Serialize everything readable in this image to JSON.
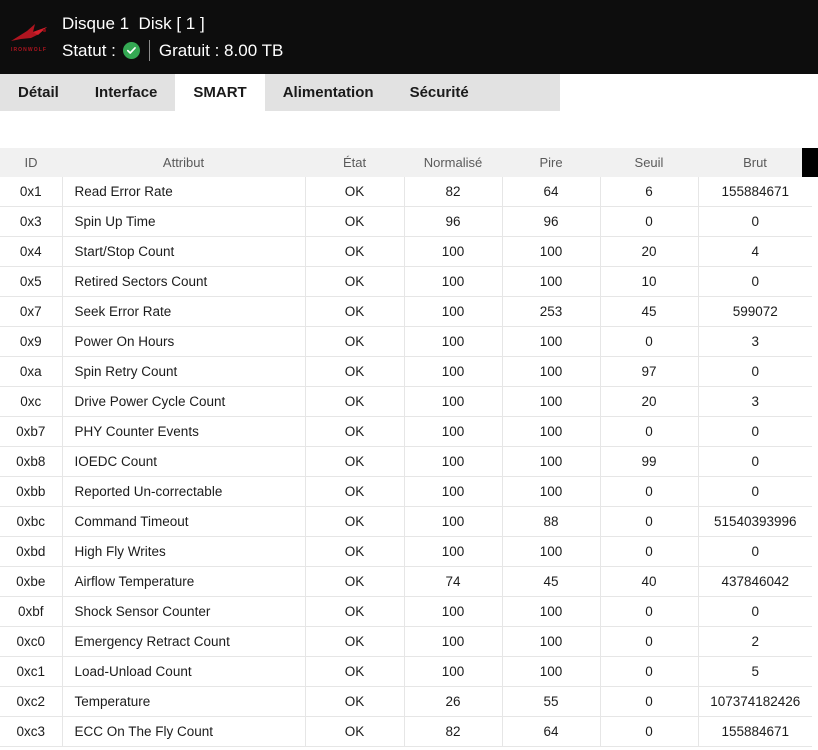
{
  "titlebar": {
    "logo_name": "ironwolf-logo",
    "logo_wordmark": "IRONWOLF",
    "disk_title": "Disque 1  Disk [ 1 ]",
    "status_label": "Statut :",
    "status_icon": "check-circle-icon",
    "status_value": "OK",
    "free_label": "Gratuit : 8.00 TB",
    "background_color": "#0d0d0d",
    "status_color": "#34a853"
  },
  "tabs": [
    {
      "label": "Détail",
      "active": false
    },
    {
      "label": "Interface",
      "active": false
    },
    {
      "label": "SMART",
      "active": true
    },
    {
      "label": "Alimentation",
      "active": false
    },
    {
      "label": "Sécurité",
      "active": false
    }
  ],
  "table": {
    "columns": [
      {
        "key": "id",
        "label": "ID"
      },
      {
        "key": "attr",
        "label": "Attribut"
      },
      {
        "key": "etat",
        "label": "État"
      },
      {
        "key": "norm",
        "label": "Normalisé"
      },
      {
        "key": "pire",
        "label": "Pire"
      },
      {
        "key": "seuil",
        "label": "Seuil"
      },
      {
        "key": "brut",
        "label": "Brut"
      }
    ],
    "rows": [
      {
        "id": "0x1",
        "attr": "Read Error Rate",
        "etat": "OK",
        "norm": "82",
        "pire": "64",
        "seuil": "6",
        "brut": "155884671"
      },
      {
        "id": "0x3",
        "attr": "Spin Up Time",
        "etat": "OK",
        "norm": "96",
        "pire": "96",
        "seuil": "0",
        "brut": "0"
      },
      {
        "id": "0x4",
        "attr": "Start/Stop Count",
        "etat": "OK",
        "norm": "100",
        "pire": "100",
        "seuil": "20",
        "brut": "4"
      },
      {
        "id": "0x5",
        "attr": "Retired Sectors Count",
        "etat": "OK",
        "norm": "100",
        "pire": "100",
        "seuil": "10",
        "brut": "0"
      },
      {
        "id": "0x7",
        "attr": "Seek Error Rate",
        "etat": "OK",
        "norm": "100",
        "pire": "253",
        "seuil": "45",
        "brut": "599072"
      },
      {
        "id": "0x9",
        "attr": "Power On Hours",
        "etat": "OK",
        "norm": "100",
        "pire": "100",
        "seuil": "0",
        "brut": "3"
      },
      {
        "id": "0xa",
        "attr": "Spin Retry Count",
        "etat": "OK",
        "norm": "100",
        "pire": "100",
        "seuil": "97",
        "brut": "0"
      },
      {
        "id": "0xc",
        "attr": "Drive Power Cycle Count",
        "etat": "OK",
        "norm": "100",
        "pire": "100",
        "seuil": "20",
        "brut": "3"
      },
      {
        "id": "0xb7",
        "attr": "PHY Counter Events",
        "etat": "OK",
        "norm": "100",
        "pire": "100",
        "seuil": "0",
        "brut": "0"
      },
      {
        "id": "0xb8",
        "attr": "IOEDC Count",
        "etat": "OK",
        "norm": "100",
        "pire": "100",
        "seuil": "99",
        "brut": "0"
      },
      {
        "id": "0xbb",
        "attr": "Reported Un-correctable",
        "etat": "OK",
        "norm": "100",
        "pire": "100",
        "seuil": "0",
        "brut": "0"
      },
      {
        "id": "0xbc",
        "attr": "Command Timeout",
        "etat": "OK",
        "norm": "100",
        "pire": "88",
        "seuil": "0",
        "brut": "51540393996"
      },
      {
        "id": "0xbd",
        "attr": "High Fly Writes",
        "etat": "OK",
        "norm": "100",
        "pire": "100",
        "seuil": "0",
        "brut": "0"
      },
      {
        "id": "0xbe",
        "attr": "Airflow Temperature",
        "etat": "OK",
        "norm": "74",
        "pire": "45",
        "seuil": "40",
        "brut": "437846042"
      },
      {
        "id": "0xbf",
        "attr": "Shock Sensor Counter",
        "etat": "OK",
        "norm": "100",
        "pire": "100",
        "seuil": "0",
        "brut": "0"
      },
      {
        "id": "0xc0",
        "attr": "Emergency Retract Count",
        "etat": "OK",
        "norm": "100",
        "pire": "100",
        "seuil": "0",
        "brut": "2"
      },
      {
        "id": "0xc1",
        "attr": "Load-Unload Count",
        "etat": "OK",
        "norm": "100",
        "pire": "100",
        "seuil": "0",
        "brut": "5"
      },
      {
        "id": "0xc2",
        "attr": "Temperature",
        "etat": "OK",
        "norm": "26",
        "pire": "55",
        "seuil": "0",
        "brut": "107374182426"
      },
      {
        "id": "0xc3",
        "attr": "ECC On The Fly Count",
        "etat": "OK",
        "norm": "82",
        "pire": "64",
        "seuil": "0",
        "brut": "155884671"
      }
    ]
  }
}
